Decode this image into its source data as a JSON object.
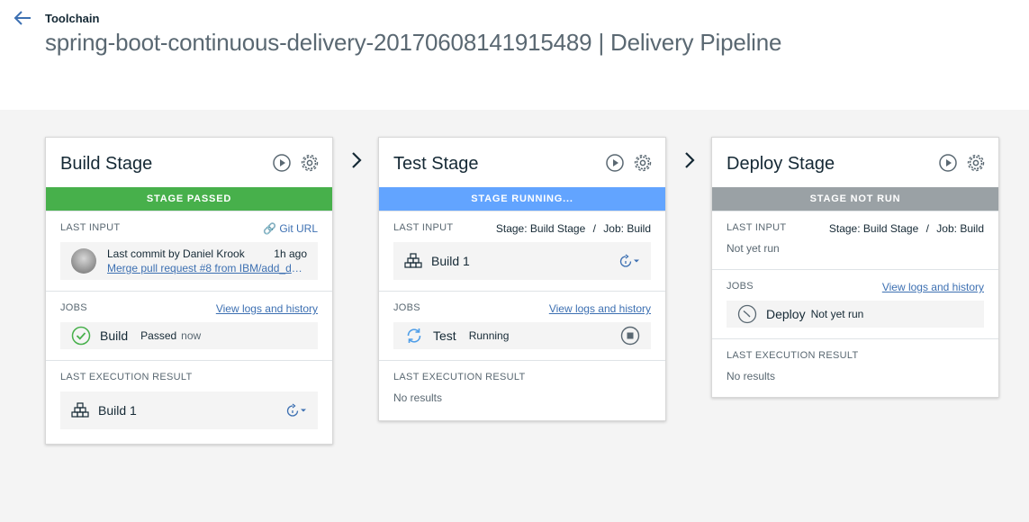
{
  "header": {
    "breadcrumb": "Toolchain",
    "title": "spring-boot-continuous-delivery-20170608141915489 | Delivery Pipeline"
  },
  "colors": {
    "passed": "#47b04b",
    "running": "#62a4ff",
    "not_run": "#9aa1a5",
    "link": "#3d70b2"
  },
  "stages": [
    {
      "name": "Build Stage",
      "status": "STAGE PASSED",
      "last_input": {
        "label": "LAST INPUT",
        "source": "Git URL",
        "commit_author": "Last commit by Daniel Krook",
        "commit_time": "1h ago",
        "commit_message": "Merge pull request #8 from IBM/add_dev..."
      },
      "jobs": {
        "label": "JOBS",
        "history_link": "View logs and history",
        "items": [
          {
            "name": "Build",
            "status": "Passed",
            "time": "now",
            "icon": "check-circle-icon"
          }
        ]
      },
      "last_result": {
        "label": "LAST EXECUTION RESULT",
        "value": "Build 1"
      }
    },
    {
      "name": "Test Stage",
      "status": "STAGE RUNNING...",
      "last_input": {
        "label": "LAST INPUT",
        "source_stage": "Stage: Build Stage",
        "separator": "/",
        "source_job": "Job: Build",
        "value": "Build 1"
      },
      "jobs": {
        "label": "JOBS",
        "history_link": "View logs and history",
        "items": [
          {
            "name": "Test",
            "status": "Running",
            "icon": "sync-icon"
          }
        ]
      },
      "last_result": {
        "label": "LAST EXECUTION RESULT",
        "value": "No results"
      }
    },
    {
      "name": "Deploy Stage",
      "status": "STAGE NOT RUN",
      "last_input": {
        "label": "LAST INPUT",
        "source_stage": "Stage: Build Stage",
        "separator": "/",
        "source_job": "Job: Build",
        "value": "Not yet run"
      },
      "jobs": {
        "label": "JOBS",
        "history_link": "View logs and history",
        "items": [
          {
            "name": "Deploy",
            "status": "Not yet run",
            "icon": "clock-icon"
          }
        ]
      },
      "last_result": {
        "label": "LAST EXECUTION RESULT",
        "value": "No results"
      }
    }
  ]
}
